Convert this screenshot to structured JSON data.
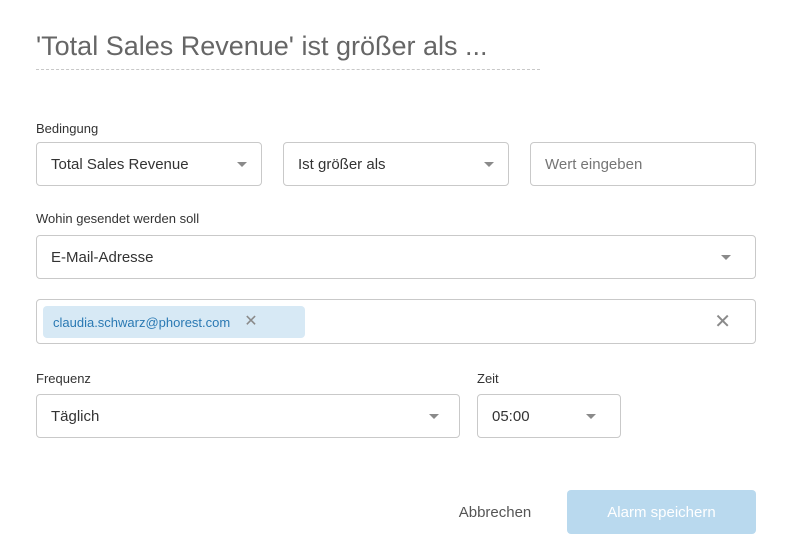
{
  "dialog": {
    "title": "'Total Sales Revenue' ist größer als ..."
  },
  "condition": {
    "label": "Bedingung",
    "metric_value": "Total Sales Revenue",
    "operator_value": "Ist größer als",
    "value_placeholder": "Wert eingeben"
  },
  "destination": {
    "label": "Wohin gesendet werden soll",
    "type_value": "E-Mail-Adresse",
    "recipients": [
      "claudia.schwarz@phorest.com"
    ],
    "chip_remove_glyph": "✕",
    "clear_glyph": "✕"
  },
  "frequency": {
    "label": "Frequenz",
    "value": "Täglich"
  },
  "time": {
    "label": "Zeit",
    "value": "05:00"
  },
  "actions": {
    "cancel_label": "Abbrechen",
    "save_label": "Alarm speichern"
  },
  "colors": {
    "chip_background": "#d7e9f5",
    "chip_text": "#2a79b3",
    "save_button_disabled": "#b9d9ee"
  }
}
